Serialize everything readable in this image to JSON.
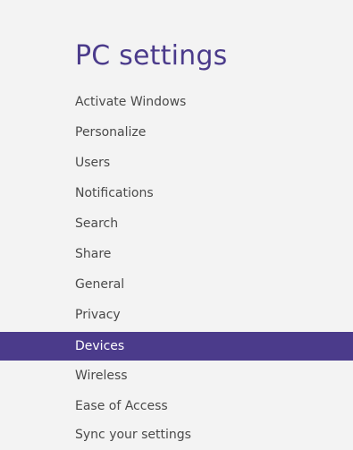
{
  "header": {
    "title": "PC settings"
  },
  "nav": {
    "items": [
      {
        "label": "Activate Windows"
      },
      {
        "label": "Personalize"
      },
      {
        "label": "Users"
      },
      {
        "label": "Notifications"
      },
      {
        "label": "Search"
      },
      {
        "label": "Share"
      },
      {
        "label": "General"
      },
      {
        "label": "Privacy"
      },
      {
        "label": "Devices",
        "selected": true
      },
      {
        "label": "Wireless"
      },
      {
        "label": "Ease of Access"
      },
      {
        "label": "Sync your settings"
      }
    ]
  },
  "colors": {
    "background": "#f3f3f3",
    "accent": "#4b3b8b",
    "text": "#4a4a4a",
    "selected_text": "#ffffff"
  }
}
